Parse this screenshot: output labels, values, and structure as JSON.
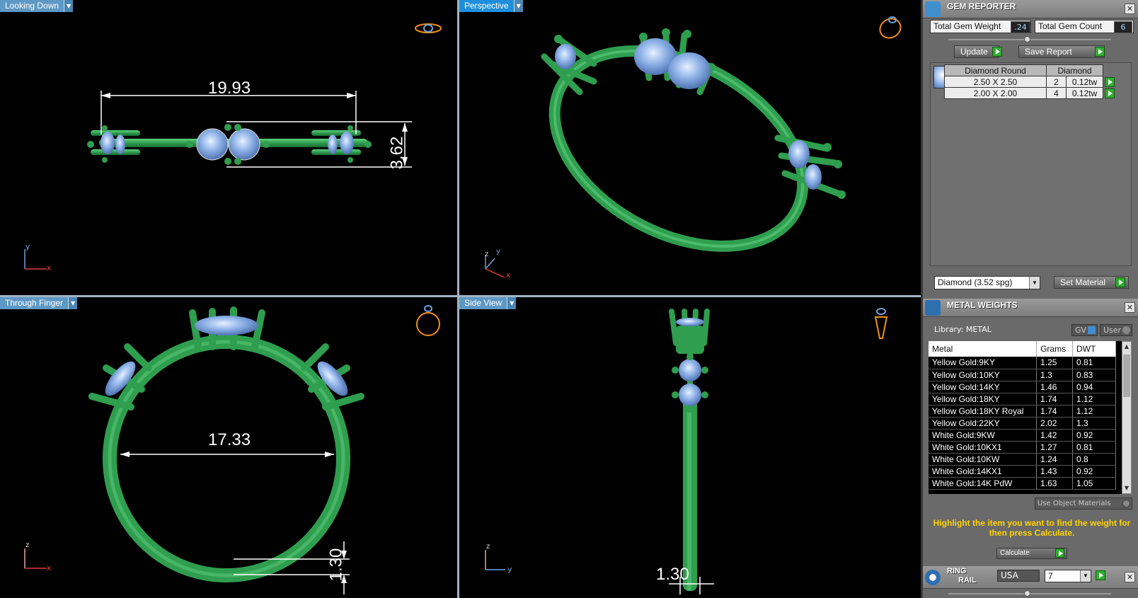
{
  "viewports": {
    "looking_down": {
      "label": "Looking Down",
      "dim_width": "19.93",
      "dim_height": "3.62"
    },
    "perspective": {
      "label": "Perspective"
    },
    "through_finger": {
      "label": "Through Finger",
      "dim_inner": "17.33",
      "dim_thickness": "1.30"
    },
    "side_view": {
      "label": "Side View",
      "dim_thickness": "1.30"
    }
  },
  "axes": {
    "x": "x",
    "y": "y",
    "z": "z"
  },
  "gem_reporter": {
    "title": "GEM REPORTER",
    "total_weight_label": "Total Gem Weight",
    "total_weight_value": ".24",
    "total_count_label": "Total Gem Count",
    "total_count_value": "6",
    "update_label": "Update",
    "save_label": "Save Report",
    "table_headers": [
      "Diamond Round",
      "Diamond"
    ],
    "rows": [
      {
        "size": "2.50 X 2.50",
        "count": "2",
        "weight": "0.12tw"
      },
      {
        "size": "2.00 X 2.00",
        "count": "4",
        "weight": "0.12tw"
      }
    ],
    "material_select": "Diamond    (3.52 spg)",
    "set_material_label": "Set Material"
  },
  "metal_weights": {
    "title": "METAL WEIGHTS",
    "library_label": "Library: METAL",
    "gv_label": "GV",
    "user_label": "User",
    "columns": [
      "Metal",
      "Grams",
      "DWT"
    ],
    "rows": [
      {
        "metal": "Yellow Gold:9KY",
        "grams": "1.25",
        "dwt": "0.81"
      },
      {
        "metal": "Yellow Gold:10KY",
        "grams": "1.3",
        "dwt": "0.83"
      },
      {
        "metal": "Yellow Gold:14KY",
        "grams": "1.46",
        "dwt": "0.94"
      },
      {
        "metal": "Yellow Gold:18KY",
        "grams": "1.74",
        "dwt": "1.12"
      },
      {
        "metal": "Yellow Gold:18KY Royal",
        "grams": "1.74",
        "dwt": "1.12"
      },
      {
        "metal": "Yellow Gold:22KY",
        "grams": "2.02",
        "dwt": "1.3"
      },
      {
        "metal": "White Gold:9KW",
        "grams": "1.42",
        "dwt": "0.92"
      },
      {
        "metal": "White Gold:10KX1",
        "grams": "1.27",
        "dwt": "0.81"
      },
      {
        "metal": "White Gold:10KW",
        "grams": "1.24",
        "dwt": "0.8"
      },
      {
        "metal": "White Gold:14KX1",
        "grams": "1.43",
        "dwt": "0.92"
      },
      {
        "metal": "White Gold:14K PdW",
        "grams": "1.63",
        "dwt": "1.05"
      }
    ],
    "use_object_materials_label": "Use Object Materials",
    "note": "Highlight the item you want to find the weight for then press Calculate.",
    "calculate_label": "Calculate"
  },
  "ring_rail": {
    "title_line1": "RING",
    "title_line2": "RAIL",
    "country": "USA",
    "size": "7"
  },
  "colors": {
    "ring_green": "#2f9e4f",
    "gem_blue": "#8fb3e8",
    "viewport_label": "#5e98c4",
    "highlight_label": "#1f8fdc",
    "note_yellow": "#ffd400"
  }
}
